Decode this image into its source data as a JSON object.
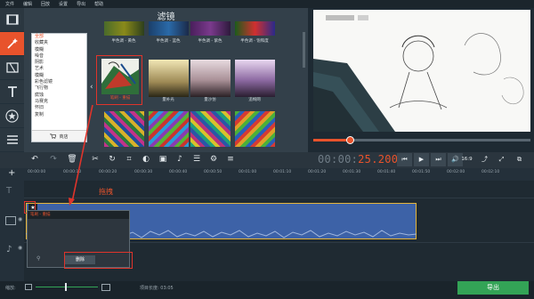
{
  "menu": {
    "items": [
      "文件",
      "编辑",
      "回放",
      "设置",
      "导出",
      "帮助"
    ]
  },
  "filters_panel": {
    "title": "滤镜",
    "categories": [
      "全部",
      "收藏夹",
      "模糊",
      "噪音",
      "阴影",
      "艺术",
      "模糊",
      "彩色滤镜",
      "飞行物",
      "腐蚀",
      "马赛克",
      "怀旧",
      "复制"
    ],
    "shop_label": "商店",
    "top_labels": [
      "半色调 - 黄色",
      "半色调 - 蓝色",
      "半色调 - 紫色",
      "半色调 - 饱和度"
    ],
    "middle_labels": [
      "笔刷 - 重描",
      "量补光",
      "量沙仿",
      "追绚网"
    ]
  },
  "timecode": {
    "prefix": "00:00:",
    "highlight": "25.200"
  },
  "aspect_label": "16:9",
  "ruler": {
    "ticks": [
      "00:00:00",
      "00:00:10",
      "00:00:20",
      "00:00:30",
      "00:00:40",
      "00:00:50",
      "00:01:00",
      "00:01:10",
      "00:01:20",
      "00:01:30",
      "00:01:40",
      "00:01:50",
      "00:02:00",
      "00:02:10"
    ]
  },
  "drag_annotation": "拖拽",
  "popup": {
    "title": "笔刷 - 重描",
    "delete_label": "删除"
  },
  "status": {
    "zoom_label": "缩放:",
    "length_label": "项目长度: 03:05"
  },
  "export_label": "导出",
  "colors": {
    "accent": "#e8532c",
    "clip": "#3d62a7",
    "export": "#33a356",
    "annotation": "#e0342b"
  }
}
